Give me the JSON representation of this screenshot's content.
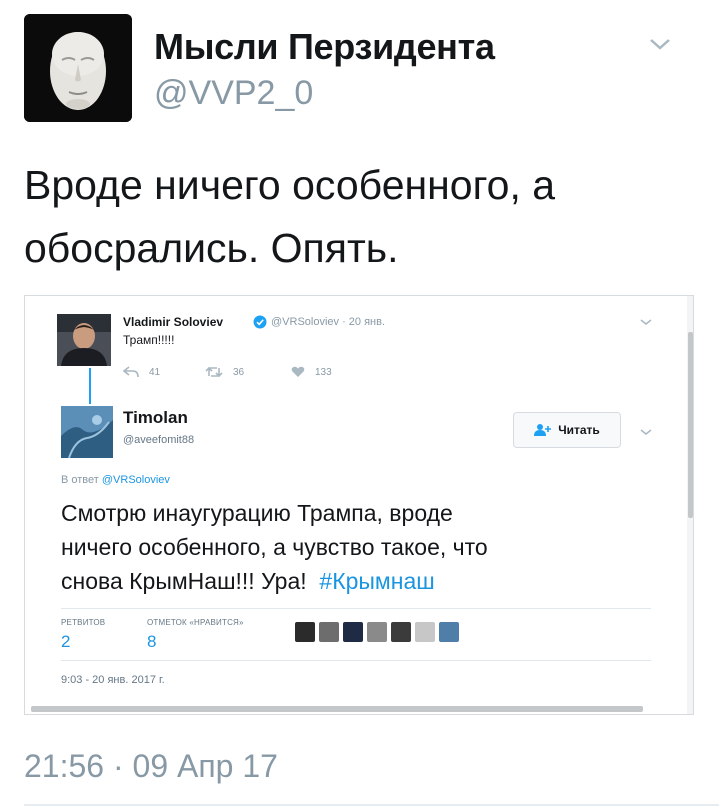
{
  "tweet": {
    "display_name": "Мысли Перзидента",
    "handle": "@VVP2_0",
    "text_lines": [
      "Вроде ничего особенного, а",
      "обосрались. Опять."
    ],
    "timestamp": "21:56 · 09 Апр 17",
    "menu_icon": "chevron-down-icon",
    "avatar_icon": "death-mask-portrait"
  },
  "embedded": {
    "original": {
      "name": "Vladimir Soloviev",
      "verified_icon": "verified-badge-icon",
      "meta": "@VRSoloviev · 20 янв.",
      "text": "Трамп!!!!!",
      "actions": {
        "reply_count": "41",
        "retweet_count": "36",
        "like_count": "133"
      }
    },
    "reply": {
      "name": "Timolan",
      "handle": "@aveefomit88",
      "follow_label": "Читать",
      "reply_to_prefix": "В ответ",
      "reply_to_mention": "@VRSoloviev",
      "text_parts": [
        "Смотрю инаугурацию Трампа, вроде",
        "ничего особенного, а чувство такое, что",
        "снова КрымНаш!!! Ура!"
      ],
      "hashtag": "#Крымнаш",
      "retweets_label": "РЕТВИТОВ",
      "retweets_count": "2",
      "likes_label": "ОТМЕТОК «НРАВИТСЯ»",
      "likes_count": "8",
      "date": "9:03 - 20 янв. 2017 г."
    }
  },
  "colors": {
    "link": "#1b95e0",
    "muted": "#8899a6",
    "text": "#14171a",
    "thread": "#1da1f2"
  }
}
